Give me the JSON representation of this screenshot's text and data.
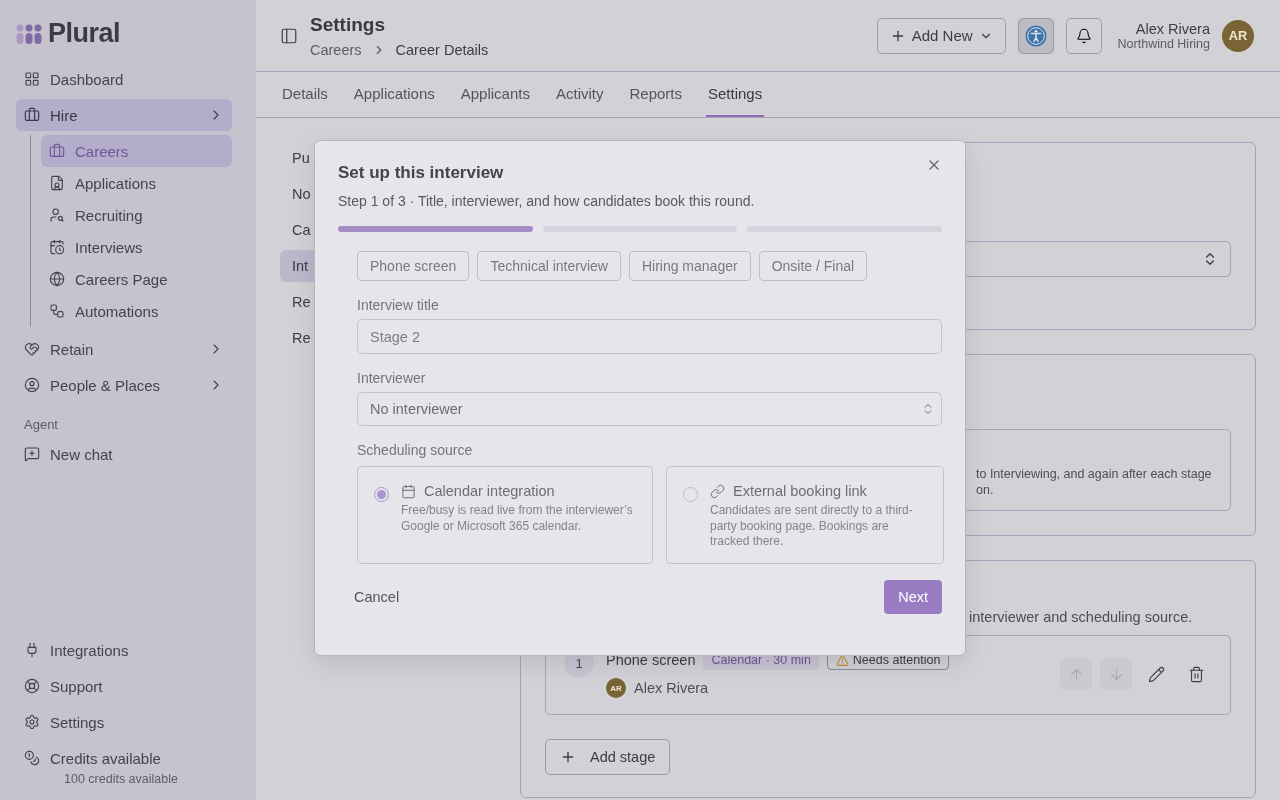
{
  "brand": {
    "name": "Plural"
  },
  "sidebar": {
    "items": [
      {
        "label": "Dashboard",
        "kind": "link",
        "selected": false
      },
      {
        "label": "Hire",
        "kind": "group",
        "selected": true,
        "children": [
          {
            "label": "Careers",
            "selected": true
          },
          {
            "label": "Applications",
            "selected": false
          },
          {
            "label": "Recruiting",
            "selected": false
          },
          {
            "label": "Interviews",
            "selected": false
          },
          {
            "label": "Careers Page",
            "selected": false
          },
          {
            "label": "Automations",
            "selected": false
          }
        ]
      },
      {
        "label": "Retain",
        "kind": "group",
        "selected": false
      },
      {
        "label": "People & Places",
        "kind": "group",
        "selected": false
      }
    ],
    "section_label": "Agent",
    "agent_items": [
      {
        "label": "New chat"
      }
    ],
    "footer_items": [
      {
        "label": "Integrations"
      },
      {
        "label": "Support"
      },
      {
        "label": "Settings"
      }
    ],
    "credits": {
      "label": "Credits available",
      "detail": "100 credits available"
    }
  },
  "header": {
    "title": "Settings",
    "breadcrumb": [
      "Careers",
      "Career Details"
    ],
    "add_button": "Add New",
    "user": {
      "name": "Alex Rivera",
      "org": "Northwind Hiring",
      "initials": "AR"
    }
  },
  "tabs": [
    {
      "label": "Details",
      "selected": false
    },
    {
      "label": "Applications",
      "selected": false
    },
    {
      "label": "Applicants",
      "selected": false
    },
    {
      "label": "Activity",
      "selected": false
    },
    {
      "label": "Reports",
      "selected": false
    },
    {
      "label": "Settings",
      "selected": true
    }
  ],
  "settings_nav": [
    {
      "label": "Pu",
      "selected": false
    },
    {
      "label": "No",
      "selected": false
    },
    {
      "label": "Ca",
      "selected": false
    },
    {
      "label": "Int",
      "selected": true
    },
    {
      "label": "Re",
      "selected": false
    },
    {
      "label": "Re",
      "selected": false
    }
  ],
  "shared_settings": {
    "toggle_description_lines": [
      "to Interviewing, and again after each stage",
      "on."
    ]
  },
  "interview_stages": {
    "description": "interviewer and scheduling source.",
    "stages": [
      {
        "number": "1",
        "name": "Phone screen",
        "tag": "Calendar · 30 min",
        "warning": "Needs attention",
        "interviewer": {
          "initials": "AR",
          "name": "Alex Rivera"
        },
        "actions": [
          {
            "kind": "up",
            "disabled": true
          },
          {
            "kind": "down",
            "disabled": true
          },
          {
            "kind": "edit",
            "disabled": false
          },
          {
            "kind": "delete",
            "disabled": false
          }
        ]
      }
    ],
    "add_button": "Add stage"
  },
  "modal": {
    "title": "Set up this interview",
    "step": "Step 1 of 3 · Title, interviewer, and how candidates book this round.",
    "progress": [
      {
        "done": true
      },
      {
        "done": false
      },
      {
        "done": false
      }
    ],
    "presets": [
      "Phone screen",
      "Technical interview",
      "Hiring manager",
      "Onsite / Final"
    ],
    "fields": [
      {
        "label": "Interview title",
        "kind": "text",
        "placeholder": "Stage 2"
      },
      {
        "label": "Interviewer",
        "kind": "select",
        "value": "No interviewer"
      }
    ],
    "scheduling": {
      "label": "Scheduling source",
      "options": [
        {
          "title": "Calendar integration",
          "kind": "calendar",
          "description": "Free/busy is read live from the interviewer’s Google or Microsoft 365 calendar.",
          "selected": true
        },
        {
          "title": "External booking link",
          "kind": "link",
          "description": "Candidates are sent directly to a third-party booking page. Bookings are tracked there.",
          "selected": false
        }
      ]
    },
    "cancel": "Cancel",
    "next": "Next"
  }
}
